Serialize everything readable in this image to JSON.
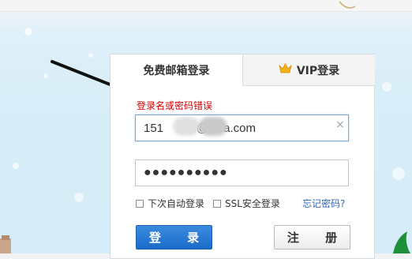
{
  "tabs": {
    "free_label": "免费邮箱登录",
    "vip_label": "VIP登录",
    "vip_icon": "crown-icon"
  },
  "form": {
    "error_text": "登录名或密码错误",
    "email_value": "151        9@sina.com",
    "password_value": "●●●●●●●●●●",
    "clear_icon": "×",
    "auto_login_label": "下次自动登录",
    "ssl_label": "SSL安全登录",
    "forgot_label": "忘记密码?",
    "login_button": "登 录",
    "register_button": "注 册"
  },
  "colors": {
    "error": "#d40000",
    "link": "#2d67b5",
    "primary_button": "#1a6cc8"
  }
}
